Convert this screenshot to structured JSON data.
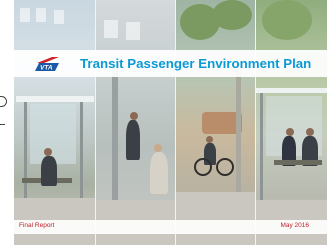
{
  "cover": {
    "logo_text": "VTA",
    "title": "Transit Passenger Environment Plan",
    "report_type": "Final Report",
    "date": "May 2016"
  },
  "colors": {
    "title": "#0a9ad6",
    "footer_text": "#c2202a",
    "logo_red": "#d0202a",
    "logo_blue": "#1c5aa6"
  },
  "photos": [
    {
      "subject": "bus-shelter-with-seated-passenger"
    },
    {
      "subject": "bus-stop-sidewalk-with-pedestrians"
    },
    {
      "subject": "transit-stop-with-bicycle-and-rider"
    },
    {
      "subject": "bus-shelter-with-waiting-passengers"
    }
  ]
}
